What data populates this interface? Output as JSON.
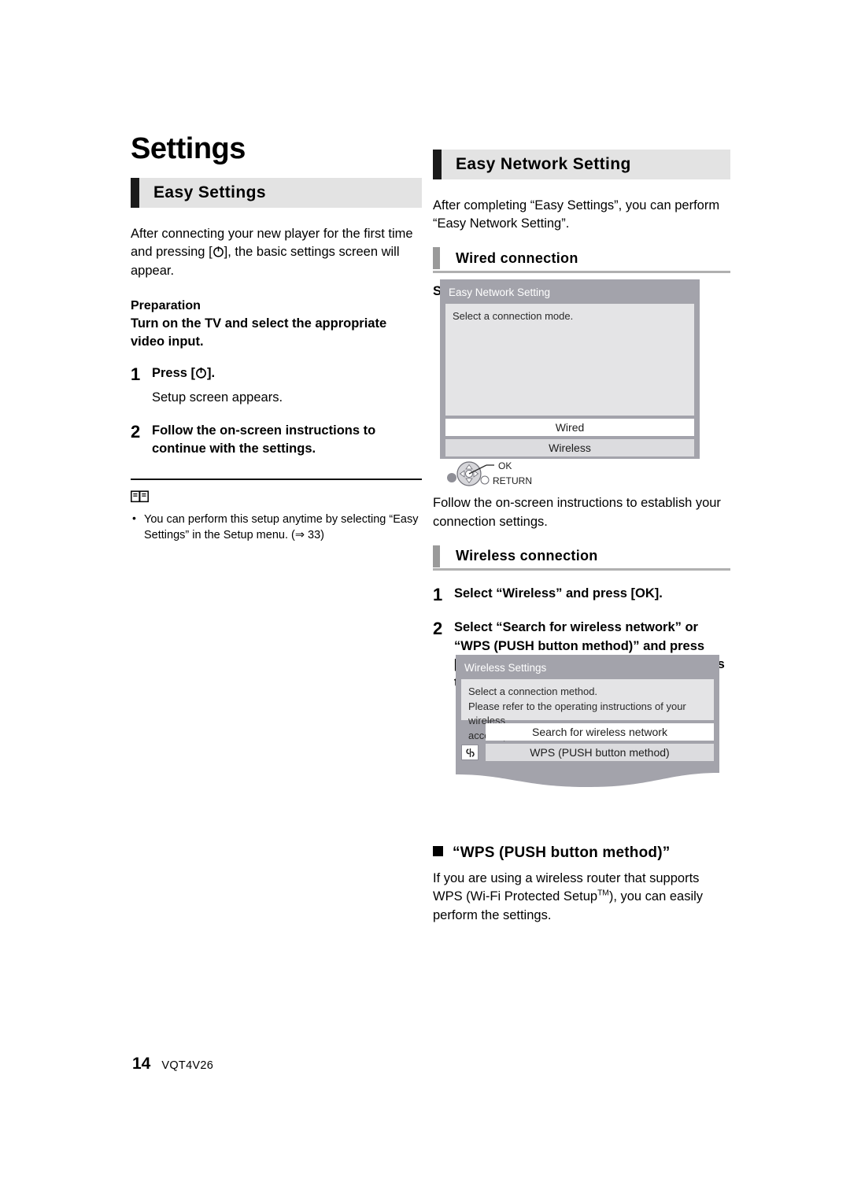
{
  "doc": {
    "title": "Settings"
  },
  "left_column": {
    "section": {
      "heading": "Easy Settings"
    },
    "intro": "After connecting your new player for the first time and pressing [⏻], the basic settings screen will appear.",
    "intro_before_glyph": "After connecting your new player for the first time and pressing [",
    "intro_after_glyph": "], the basic settings screen will appear.",
    "preparation": {
      "label": "Preparation",
      "text": "Turn on the TV and select the appropriate video input."
    },
    "steps": [
      {
        "num": "1",
        "title_before_glyph": "Press [",
        "title_after_glyph": "].",
        "title_plain": "Press [⏻].",
        "sub": "Setup screen appears."
      },
      {
        "num": "2",
        "title_plain": "Follow the on-screen instructions to continue with the settings.",
        "sub": ""
      }
    ],
    "note": {
      "icon": "book-icon",
      "items": [
        "You can perform this setup anytime by selecting “Easy Settings” in the Setup menu. (⇒ 33)"
      ]
    }
  },
  "right_column": {
    "section": {
      "heading": "Easy Network Setting"
    },
    "intro": "After completing “Easy Settings”, you can perform “Easy Network Setting”.",
    "wired": {
      "sub_heading": "Wired connection",
      "instruction": "Select “Wired” and press [OK].",
      "after_text": "Follow the on-screen instructions to establish your connection settings."
    },
    "wireless": {
      "sub_heading": "Wireless connection",
      "steps": [
        {
          "num": "1",
          "text": "Select “Wireless” and press [OK]."
        },
        {
          "num": "2",
          "text": "Select “Search for wireless network” or “WPS (PUSH button method)” and press [OK], then follow the on-screen instructions to continue with the settings."
        }
      ]
    },
    "wps_section": {
      "heading": "“WPS (PUSH button method)”",
      "body_before_tm": "If you are using a wireless router that supports WPS (Wi-Fi Protected Setup",
      "tm": "TM",
      "body_after_tm": "), you can easily perform the settings."
    }
  },
  "dialog_network": {
    "title": "Easy Network Setting",
    "panel_text": "Select a connection mode.",
    "buttons": [
      {
        "label": "Wired",
        "selected": true
      },
      {
        "label": "Wireless",
        "selected": false
      }
    ],
    "hints": [
      {
        "label": "OK",
        "icon": "dpad-center-icon"
      },
      {
        "label": "RETURN",
        "icon": "return-dot-icon"
      }
    ]
  },
  "dialog_wireless": {
    "title": "Wireless Settings",
    "panel_lines": [
      "Select a connection method.",
      "Please refer to the operating instructions of your wireless",
      "access point about connection methods."
    ],
    "buttons": [
      {
        "label": "Search for wireless network",
        "selected": true,
        "has_icon": false
      },
      {
        "label": "WPS (PUSH button method)",
        "selected": false,
        "has_icon": true,
        "icon": "wps-link-icon"
      }
    ]
  },
  "footer": {
    "page_number": "14",
    "doc_code": "VQT4V26"
  },
  "colors": {
    "section_bar_bg": "#e3e3e3",
    "section_tab": "#1a1a1a",
    "sub_tab": "#9a9a9a",
    "sub_underline": "#b0b0b0",
    "dialog_frame": "#a3a3ab",
    "dialog_panel": "#e4e4e6",
    "button_selected": "#ffffff",
    "button_unselected": "#dcdcdf"
  }
}
